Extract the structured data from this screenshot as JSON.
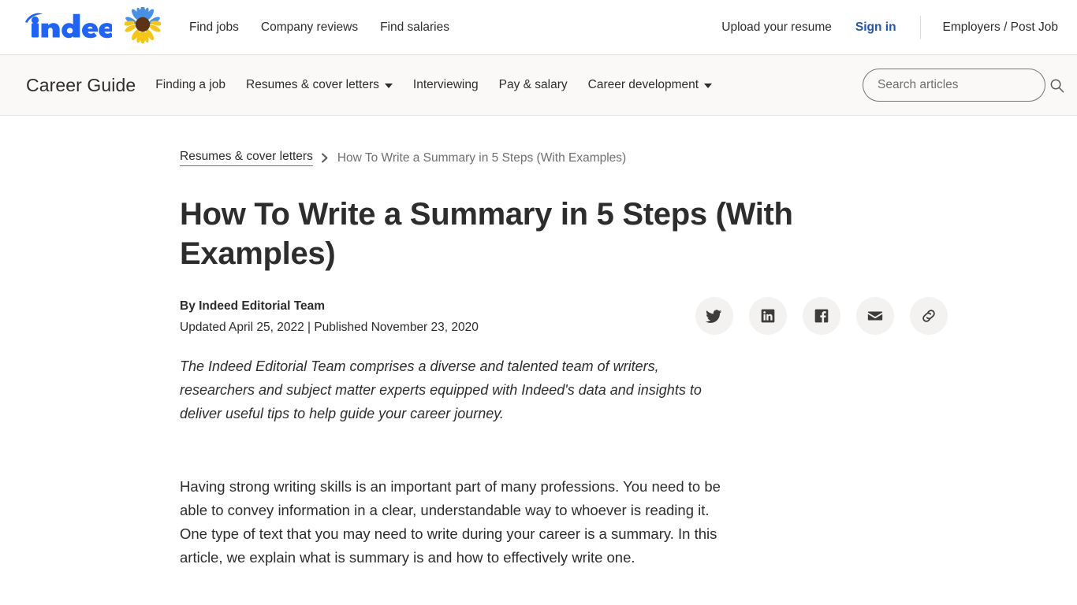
{
  "global_nav": {
    "brand_name": "indeed",
    "sunflower_icon": "sunflower-icon",
    "links": [
      {
        "label": "Find jobs"
      },
      {
        "label": "Company reviews"
      },
      {
        "label": "Find salaries"
      }
    ],
    "upload_resume": "Upload your resume",
    "sign_in": "Sign in",
    "employers": "Employers / Post Job",
    "accent_color": "#2557a7",
    "text_color": "#2d2d2d"
  },
  "subnav": {
    "title": "Career Guide",
    "items": [
      {
        "label": "Finding a job",
        "has_dropdown": false
      },
      {
        "label": "Resumes & cover letters",
        "has_dropdown": true
      },
      {
        "label": "Interviewing",
        "has_dropdown": false
      },
      {
        "label": "Pay & salary",
        "has_dropdown": false
      },
      {
        "label": "Career development",
        "has_dropdown": true
      }
    ],
    "search": {
      "placeholder": "Search articles",
      "value": "",
      "icon": "search-icon"
    },
    "background_color": "#faf9f8"
  },
  "breadcrumb": {
    "parent": "Resumes & cover letters",
    "separator": "chevron-right-icon",
    "current": "How To Write a Summary in 5 Steps (With Examples)"
  },
  "article": {
    "title": "How To Write a Summary in 5 Steps (With Examples)",
    "byline": "By Indeed Editorial Team",
    "dates": "Updated April 25, 2022 | Published November 23, 2020",
    "editorial_note": "The Indeed Editorial Team comprises a diverse and talented team of writers, researchers and subject matter experts equipped with Indeed's data and insights to deliver useful tips to help guide your career journey.",
    "first_paragraph": "Having strong writing skills is an important part of many professions. You need to be able to convey information in a clear, understandable way to whoever is reading it. One type of text that you may need to write during your career is a summary. In this article, we explain what is summary is and how to effectively write one."
  },
  "share": {
    "buttons": [
      {
        "name": "twitter-icon",
        "label": "Share on Twitter"
      },
      {
        "name": "linkedin-icon",
        "label": "Share on LinkedIn"
      },
      {
        "name": "facebook-icon",
        "label": "Share on Facebook"
      },
      {
        "name": "email-icon",
        "label": "Share by email"
      },
      {
        "name": "link-icon",
        "label": "Copy link"
      }
    ],
    "button_background": "#f3f2f1",
    "icon_color": "#3c3c3c"
  }
}
